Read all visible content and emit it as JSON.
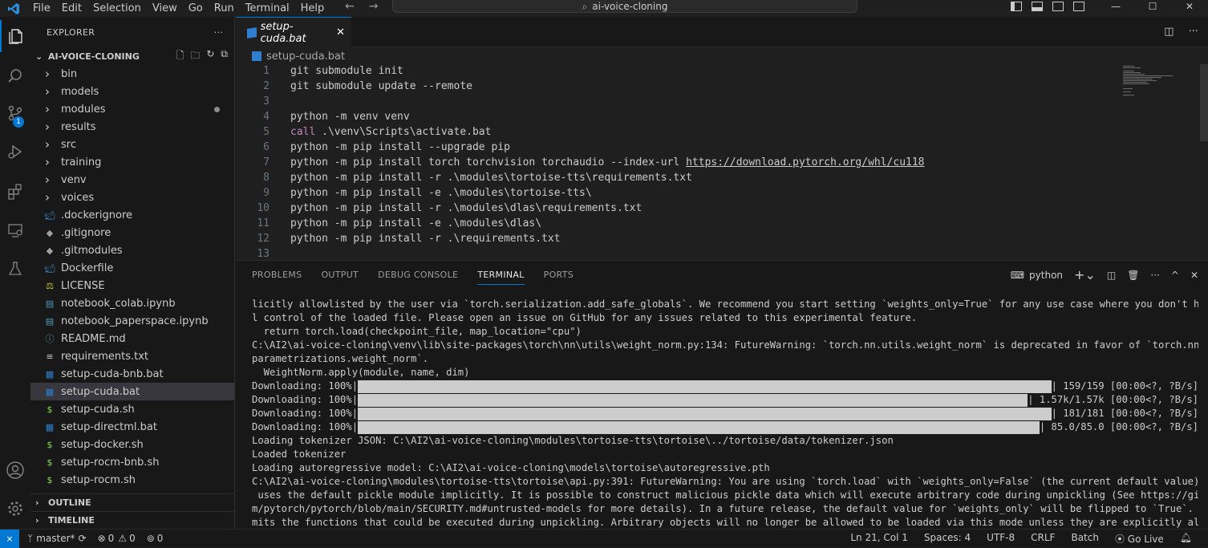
{
  "menu": [
    "File",
    "Edit",
    "Selection",
    "View",
    "Go",
    "Run",
    "Terminal",
    "Help"
  ],
  "command_center": "ai-voice-cloning",
  "activity_badge": "1",
  "sidebar": {
    "header": "EXPLORER",
    "project": "AI-VOICE-CLONING",
    "items": [
      {
        "label": "bin",
        "type": "folder"
      },
      {
        "label": "models",
        "type": "folder"
      },
      {
        "label": "modules",
        "type": "folder"
      },
      {
        "label": "results",
        "type": "folder"
      },
      {
        "label": "src",
        "type": "folder"
      },
      {
        "label": "training",
        "type": "folder"
      },
      {
        "label": "venv",
        "type": "folder"
      },
      {
        "label": "voices",
        "type": "folder"
      },
      {
        "label": ".dockerignore",
        "type": "file"
      },
      {
        "label": ".gitignore",
        "type": "file"
      },
      {
        "label": ".gitmodules",
        "type": "file"
      },
      {
        "label": "Dockerfile",
        "type": "file"
      },
      {
        "label": "LICENSE",
        "type": "file"
      },
      {
        "label": "notebook_colab.ipynb",
        "type": "file"
      },
      {
        "label": "notebook_paperspace.ipynb",
        "type": "file"
      },
      {
        "label": "README.md",
        "type": "file"
      },
      {
        "label": "requirements.txt",
        "type": "file"
      },
      {
        "label": "setup-cuda-bnb.bat",
        "type": "file"
      },
      {
        "label": "setup-cuda.bat",
        "type": "file"
      },
      {
        "label": "setup-cuda.sh",
        "type": "file"
      },
      {
        "label": "setup-directml.bat",
        "type": "file"
      },
      {
        "label": "setup-docker.sh",
        "type": "file"
      },
      {
        "label": "setup-rocm-bnb.sh",
        "type": "file"
      },
      {
        "label": "setup-rocm.sh",
        "type": "file"
      }
    ],
    "outline": "OUTLINE",
    "timeline": "TIMELINE"
  },
  "editor": {
    "tab": "setup-cuda.bat",
    "breadcrumb": "setup-cuda.bat",
    "lines": [
      {
        "n": "1",
        "text": "git submodule init"
      },
      {
        "n": "2",
        "text": "git submodule update --remote"
      },
      {
        "n": "3",
        "text": ""
      },
      {
        "n": "4",
        "text": "python -m venv venv"
      },
      {
        "n": "5",
        "kw": "call",
        "text": " .\\venv\\Scripts\\activate.bat"
      },
      {
        "n": "6",
        "text": "python -m pip install --upgrade pip"
      },
      {
        "n": "7",
        "text": "python -m pip install torch torchvision torchaudio --index-url ",
        "url": "https://download.pytorch.org/whl/cu118"
      },
      {
        "n": "8",
        "text": "python -m pip install -r .\\modules\\tortoise-tts\\requirements.txt"
      },
      {
        "n": "9",
        "text": "python -m pip install -e .\\modules\\tortoise-tts\\"
      },
      {
        "n": "10",
        "text": "python -m pip install -r .\\modules\\dlas\\requirements.txt"
      },
      {
        "n": "11",
        "text": "python -m pip install -e .\\modules\\dlas\\"
      },
      {
        "n": "12",
        "text": "python -m pip install -r .\\requirements.txt"
      },
      {
        "n": "13",
        "text": ""
      }
    ]
  },
  "panel": {
    "tabs": [
      "PROBLEMS",
      "OUTPUT",
      "DEBUG CONSOLE",
      "TERMINAL",
      "PORTS"
    ],
    "active_tab": "TERMINAL",
    "terminal_name": "python",
    "lines_top": [
      "licitly allowlisted by the user via `torch.serialization.add_safe_globals`. We recommend you start setting `weights_only=True` for any use case where you don't have ful",
      "l control of the loaded file. Please open an issue on GitHub for any issues related to this experimental feature.",
      "  return torch.load(checkpoint_file, map_location=\"cpu\")",
      "C:\\AI2\\ai-voice-cloning\\venv\\lib\\site-packages\\torch\\nn\\utils\\weight_norm.py:134: FutureWarning: `torch.nn.utils.weight_norm` is deprecated in favor of `torch.nn.utils.",
      "parametrizations.weight_norm`.",
      "  WeightNorm.apply(module, name, dim)"
    ],
    "downloads": [
      {
        "label": "Downloading: 100%|",
        "suffix": "| 159/159 [00:00<?, ?B/s]",
        "progress": 1.0
      },
      {
        "label": "Downloading: 100%|",
        "suffix": "| 1.57k/1.57k [00:00<?, ?B/s]",
        "progress": 1.0
      },
      {
        "label": "Downloading: 100%|",
        "suffix": "| 181/181 [00:00<?, ?B/s]",
        "progress": 1.0
      },
      {
        "label": "Downloading: 100%|",
        "suffix": "| 85.0/85.0 [00:00<?, ?B/s]",
        "progress": 1.0
      }
    ],
    "lines_bottom": [
      "Loading tokenizer JSON: C:\\AI2\\ai-voice-cloning\\modules\\tortoise-tts\\tortoise\\../tortoise/data/tokenizer.json",
      "Loaded tokenizer",
      "Loading autoregressive model: C:\\AI2\\ai-voice-cloning\\models\\tortoise\\autoregressive.pth",
      "C:\\AI2\\ai-voice-cloning\\modules\\tortoise-tts\\tortoise\\api.py:391: FutureWarning: You are using `torch.load` with `weights_only=False` (the current default value), which",
      " uses the default pickle module implicitly. It is possible to construct malicious pickle data which will execute arbitrary code during unpickling (See https://github.co",
      "m/pytorch/pytorch/blob/main/SECURITY.md#untrusted-models for more details). In a future release, the default value for `weights_only` will be flipped to `True`. This li",
      "mits the functions that could be executed during unpickling. Arbitrary objects will no longer be allowed to be loaded via this mode unless they are explicitly allowlist"
    ]
  },
  "status": {
    "branch": "master*",
    "errors": "0",
    "warnings": "0",
    "ports": "0",
    "position": "Ln 21, Col 1",
    "spaces": "Spaces: 4",
    "encoding": "UTF-8",
    "eol": "CRLF",
    "language": "Batch",
    "golive": "Go Live"
  }
}
